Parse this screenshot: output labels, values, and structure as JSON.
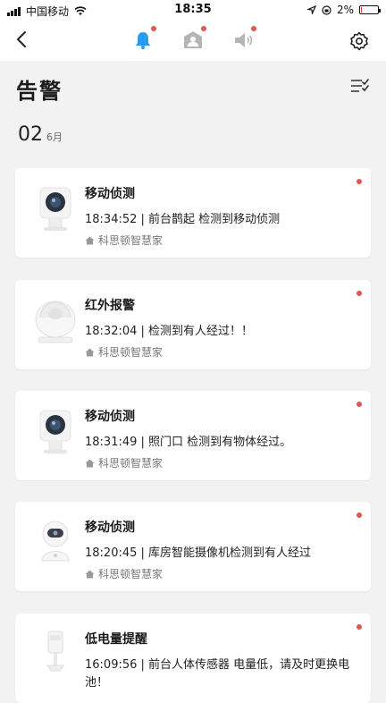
{
  "status_bar": {
    "carrier": "中国移动",
    "time": "18:35",
    "battery": "2%",
    "battery_level": 0.02
  },
  "nav": {
    "tabs": [
      {
        "name": "alerts-tab",
        "icon": "bell-icon",
        "active": true,
        "unread": true
      },
      {
        "name": "visitors-tab",
        "icon": "person-card-icon",
        "active": false,
        "unread": true
      },
      {
        "name": "sound-tab",
        "icon": "speaker-icon",
        "active": false,
        "unread": true
      }
    ]
  },
  "header": {
    "title": "告警"
  },
  "date_group": {
    "day": "02",
    "month": "6月"
  },
  "alerts": [
    {
      "title": "移动侦测",
      "detail": "18:34:52 | 前台鹊起 检测到移动侦测",
      "home": "科思顿智慧家",
      "device": "camera",
      "unread": true
    },
    {
      "title": "红外报警",
      "detail": "18:32:04 | 检测到有人经过！！",
      "home": "科思顿智慧家",
      "device": "pir-sensor",
      "unread": true
    },
    {
      "title": "移动侦测",
      "detail": "18:31:49 | 照门口 检测到有物体经过。",
      "home": "科思顿智慧家",
      "device": "camera",
      "unread": true
    },
    {
      "title": "移动侦测",
      "detail": "18:20:45 | 库房智能摄像机检测到有人经过",
      "home": "科思顿智慧家",
      "device": "robot-camera",
      "unread": true
    },
    {
      "title": "低电量提醒",
      "detail": "16:09:56 | 前台人体传感器 电量低，请及时更换电池！",
      "home": "",
      "device": "body-sensor",
      "unread": true
    }
  ],
  "colors": {
    "accent": "#2a9bf0",
    "unread_dot": "#e05555",
    "inactive_icon": "#b5b5b5"
  }
}
